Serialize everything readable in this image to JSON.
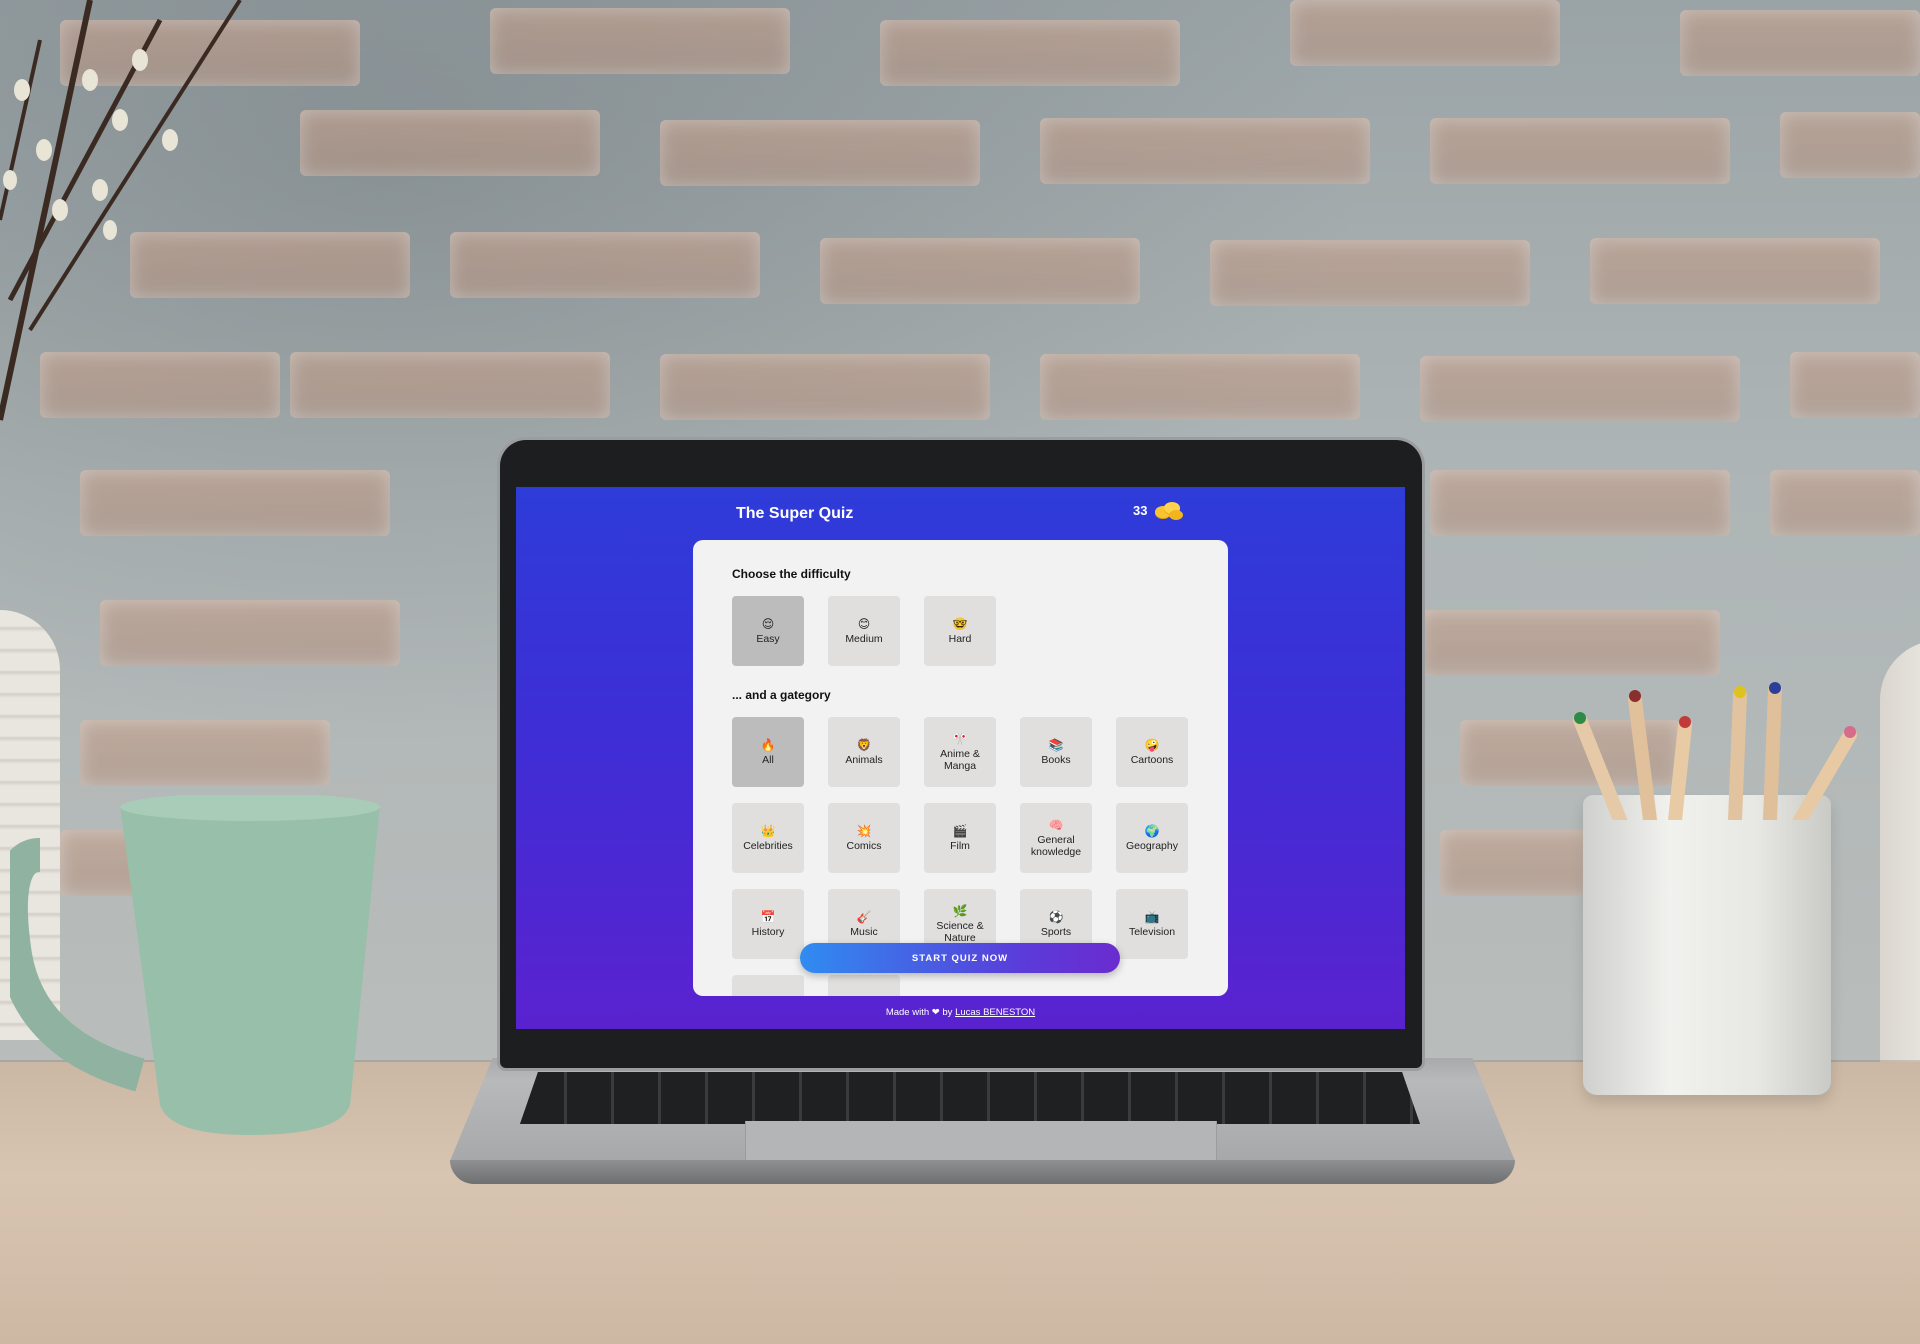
{
  "app": {
    "title": "The Super Quiz",
    "coins": "33",
    "coin_icon": "coins-icon"
  },
  "difficulty": {
    "title": "Choose the difficulty",
    "selected": "Easy",
    "options": [
      {
        "label": "Easy",
        "emoji": "😌"
      },
      {
        "label": "Medium",
        "emoji": "😊"
      },
      {
        "label": "Hard",
        "emoji": "🤓"
      }
    ]
  },
  "category": {
    "title": "... and a gategory",
    "selected": "All",
    "options": [
      {
        "label": "All",
        "emoji": "🔥"
      },
      {
        "label": "Animals",
        "emoji": "🦁"
      },
      {
        "label": "Anime & Manga",
        "emoji": "🎌"
      },
      {
        "label": "Books",
        "emoji": "📚"
      },
      {
        "label": "Cartoons",
        "emoji": "🤪"
      },
      {
        "label": "Celebrities",
        "emoji": "👑"
      },
      {
        "label": "Comics",
        "emoji": "💥"
      },
      {
        "label": "Film",
        "emoji": "🎬"
      },
      {
        "label": "General knowledge",
        "emoji": "🧠"
      },
      {
        "label": "Geography",
        "emoji": "🌍"
      },
      {
        "label": "History",
        "emoji": "📅"
      },
      {
        "label": "Music",
        "emoji": "🎸"
      },
      {
        "label": "Science & Nature",
        "emoji": "🌿"
      },
      {
        "label": "Sports",
        "emoji": "⚽"
      },
      {
        "label": "Television",
        "emoji": "📺"
      },
      {
        "label": "",
        "emoji": ""
      },
      {
        "label": "",
        "emoji": "🎮"
      }
    ]
  },
  "actions": {
    "start_label": "START QUIZ NOW"
  },
  "footer": {
    "prefix": "Made with",
    "heart": "❤",
    "middle": "by",
    "author": "Lucas BENESTON"
  },
  "colors": {
    "gradient_top": "#2e3cd8",
    "gradient_bottom": "#5a22cf",
    "button_start": "#2f8cf1",
    "button_end": "#6a2ccf",
    "tile": "#e0dfde",
    "tile_selected": "#bcbcbc"
  }
}
